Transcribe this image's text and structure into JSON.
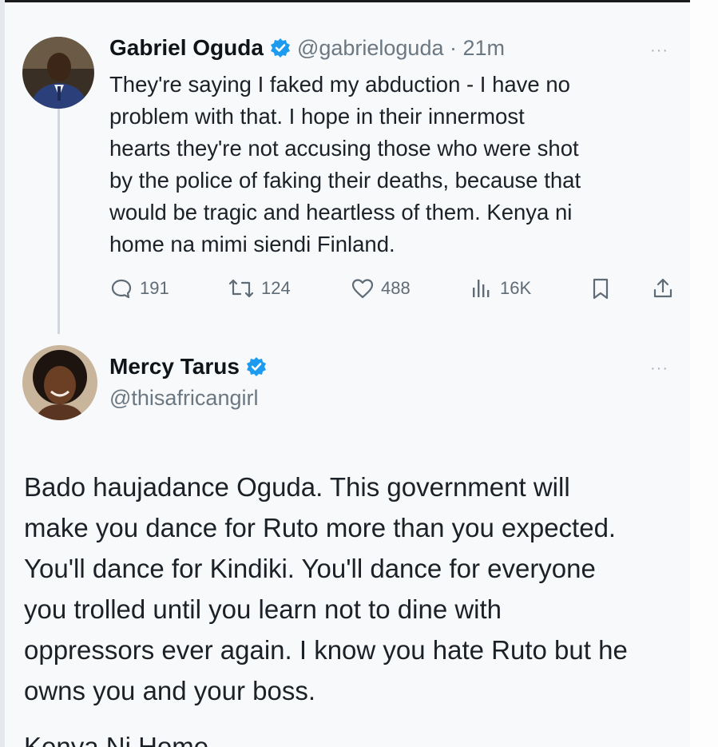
{
  "tweet1": {
    "name": "Gabriel Oguda",
    "handle_time": "@gabrieloguda · 21m",
    "more": "···",
    "lines": [
      "They're saying I faked my abduction - I have no",
      "problem with that. I hope in their innermost",
      "hearts they're not accusing those who were shot",
      "by the police of faking their deaths, because that",
      "would be tragic and heartless of them. Kenya ni",
      "home na mimi siendi Finland."
    ],
    "actions": {
      "replies": "191",
      "retweets": "124",
      "likes": "488",
      "views": "16K"
    }
  },
  "tweet2": {
    "name": "Mercy Tarus",
    "handle": "@thisafricangirl",
    "more": "···",
    "lines": [
      "Bado haujadance Oguda. This government will",
      "make you dance for Ruto more than you expected.",
      "You'll dance for Kindiki. You'll dance for everyone",
      "you trolled until you learn not to dine with",
      "oppressors ever again. I know you hate Ruto but he",
      "owns you and your boss."
    ],
    "cut_line": "Kenya Ni Home"
  },
  "colors": {
    "verified": "#1d9bf0",
    "panel_bg": "#f7f9fb",
    "muted": "#6b7781"
  }
}
